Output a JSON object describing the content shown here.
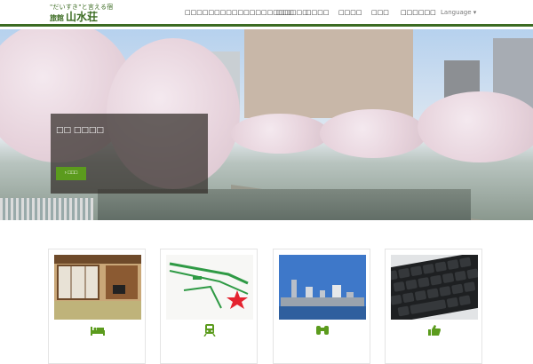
{
  "header": {
    "tagline": "\"だいすき\"と言える宿",
    "logo_small": "旅館",
    "logo_main": "山水荘"
  },
  "nav": {
    "items": [
      "□□□□□□□□□□□□□□□□□□□□□",
      "□□□",
      "□□□□",
      "□□□□",
      "□□□",
      "□□□□□□"
    ],
    "language": "Language ▾"
  },
  "hero": {
    "title": "□□ □□□□",
    "button_label": "› □□□"
  },
  "cards": [
    {
      "icon": "bed-icon"
    },
    {
      "icon": "train-icon"
    },
    {
      "icon": "binoculars-icon"
    },
    {
      "icon": "thumbs-up-icon"
    }
  ],
  "colors": {
    "brand": "#3b6b22",
    "button": "#5b9b1d"
  }
}
